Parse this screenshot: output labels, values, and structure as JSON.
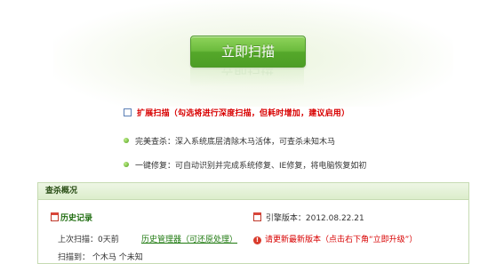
{
  "scan": {
    "button_label": "立即扫描"
  },
  "deep_scan": {
    "label": "扩展扫描（勾选将进行深度扫描，但耗时增加，建议启用）",
    "checked": false
  },
  "features": [
    {
      "text": "完美查杀：深入系统底层清除木马活体，可查杀未知木马"
    },
    {
      "text": "一键修复：可自动识别并完成系统修复、IE修复，将电脑恢复如初"
    }
  ],
  "overview": {
    "title": "查杀概况",
    "history": {
      "title": "历史记录",
      "last_scan": "上次扫描：0天前",
      "manager_link": "历史管理器（可还原处理）"
    },
    "engine_version": "引擎版本：2012.08.22.21",
    "update_notice": "请更新最新版本（点击右下角“立即升级”）",
    "cut_row": "扫描到：   个木马    个未知"
  },
  "colors": {
    "accent_green": "#6bbb3c",
    "warning_red": "#d80000",
    "link_green": "#1f7a10"
  }
}
